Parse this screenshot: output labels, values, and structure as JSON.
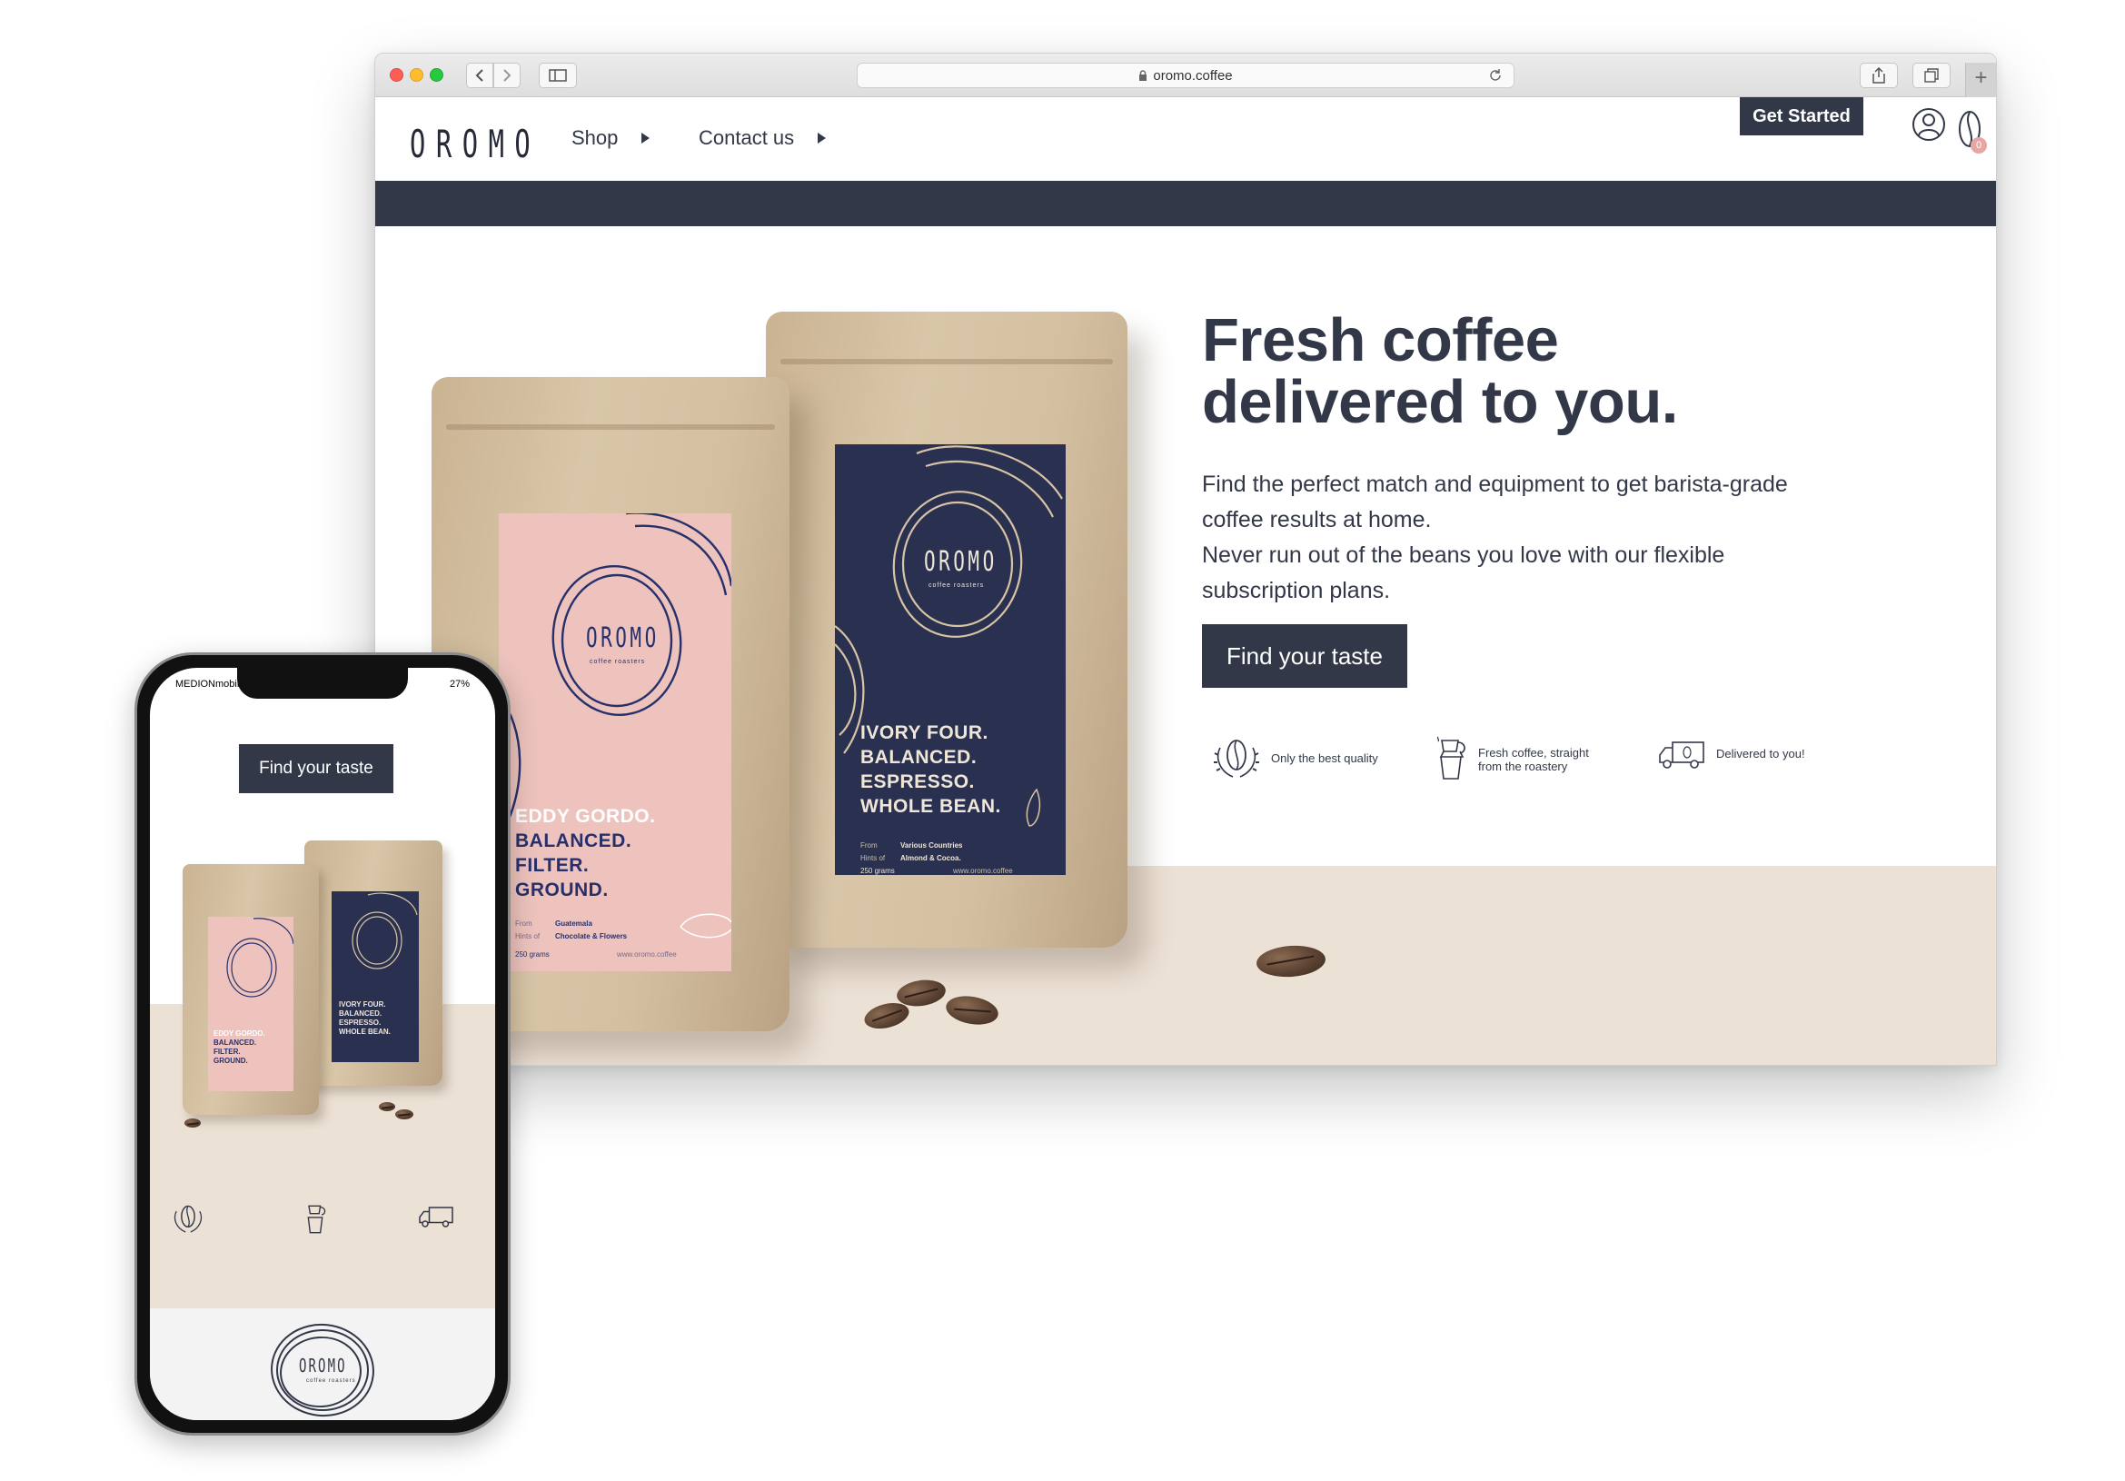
{
  "browser": {
    "url": "oromo.coffee",
    "new_tab_symbol": "+"
  },
  "site": {
    "logo": "OROMO",
    "nav": [
      {
        "label": "Shop"
      },
      {
        "label": "Contact us"
      }
    ],
    "get_started": "Get Started",
    "cart_count": "0",
    "icons": [
      "user-icon",
      "coffee-bean-cart-icon"
    ]
  },
  "hero": {
    "title_line1": "Fresh coffee",
    "title_line2": "delivered to you.",
    "subtitle_line1": "Find the perfect match and equipment to get barista-grade coffee results at home.",
    "subtitle_line2": "Never run out of the beans you love with our flexible subscription plans.",
    "cta": "Find your taste",
    "features": [
      {
        "icon": "coffee-bean-laurel-icon",
        "text": "Only the best quality"
      },
      {
        "icon": "moka-pot-icon",
        "text": "Fresh coffee, straight from the roastery"
      },
      {
        "icon": "delivery-truck-icon",
        "text": "Delivered to you!"
      }
    ]
  },
  "bags": {
    "pink": {
      "brand": "OROMO",
      "brand_sub": "coffee roasters",
      "lines": [
        "EDDY GORDO.",
        "BALANCED.",
        "FILTER.",
        "GROUND."
      ],
      "from_label": "From",
      "from_value": "Guatemala",
      "hints_label": "Hints of",
      "hints_value": "Chocolate & Flowers",
      "weight": "250 grams",
      "site": "www.oromo.coffee",
      "label_color": "#eec3bd",
      "ink_color": "#27306b"
    },
    "navy": {
      "brand": "OROMO",
      "brand_sub": "coffee roasters",
      "lines": [
        "IVORY FOUR.",
        "BALANCED.",
        "ESPRESSO.",
        "WHOLE BEAN."
      ],
      "from_label": "From",
      "from_value": "Various Countries",
      "hints_label": "Hints of",
      "hints_value": "Almond & Cocoa.",
      "weight": "250 grams",
      "site": "www.oromo.coffee",
      "label_color": "#2a3150",
      "ink_color": "#efe6d8"
    }
  },
  "phone": {
    "carrier": "MEDIONmobile",
    "battery": "27%",
    "cta": "Find your taste",
    "pink_lines": [
      "EDDY GORDO.",
      "BALANCED.",
      "FILTER.",
      "GROUND."
    ],
    "navy_lines": [
      "IVORY FOUR.",
      "BALANCED.",
      "ESPRESSO.",
      "WHOLE BEAN."
    ],
    "footer_logo": "OROMO",
    "footer_logo_sub": "coffee roasters"
  },
  "colors": {
    "brand_dark": "#323848",
    "sand": "#ece1d5",
    "pink_label": "#eec3bd",
    "navy_label": "#2a3150"
  }
}
